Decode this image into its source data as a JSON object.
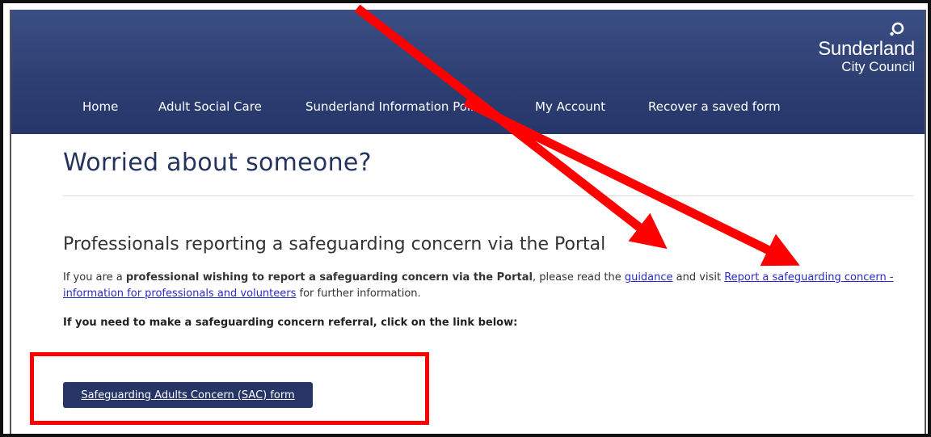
{
  "brand": {
    "name": "Sunderland",
    "subtitle": "City Council",
    "header_color": "#2e3f72"
  },
  "nav": {
    "items": [
      {
        "label": "Home"
      },
      {
        "label": "Adult Social Care"
      },
      {
        "label": "Sunderland Information Point"
      },
      {
        "label": "My Account"
      },
      {
        "label": "Recover a saved form"
      }
    ]
  },
  "page": {
    "title": "Worried about someone?",
    "section_heading": "Professionals reporting a safeguarding concern via the Portal",
    "paragraph": {
      "intro": "If you are a ",
      "bold": "professional wishing to report a safeguarding concern via the Portal",
      "middle": ", please read the ",
      "guidance_link": "guidance",
      "visit": " and visit ",
      "report_link": "Report a safeguarding concern - information for professionals and volunteers",
      "outro": " for further information."
    },
    "instruction": "If you need to make a safeguarding concern referral, click on the link below:",
    "sac_button_label": "Safeguarding Adults Concern (SAC) form"
  },
  "annotations": {
    "arrow_color": "#ff0000",
    "highlight_color": "#ff0000"
  }
}
